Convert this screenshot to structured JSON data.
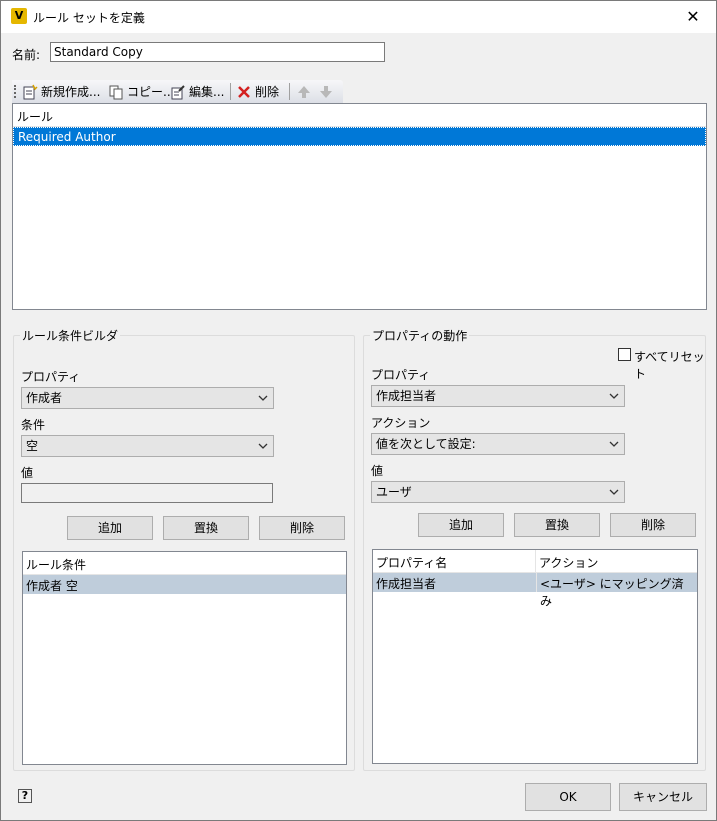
{
  "window": {
    "title": "ルール セットを定義",
    "app_icon_letter": "V",
    "close_glyph": "✕"
  },
  "name": {
    "label": "名前:",
    "value": "Standard Copy"
  },
  "toolbar": {
    "new_label": "新規作成...",
    "copy_label": "コピー...",
    "edit_label": "編集...",
    "delete_label": "削除"
  },
  "rules": {
    "header": "ルール",
    "items": [
      "Required Author"
    ]
  },
  "condition_builder": {
    "legend": "ルール条件ビルダ",
    "property_label": "プロパティ",
    "property_value": "作成者",
    "condition_label": "条件",
    "condition_value": "空",
    "value_label": "値",
    "value_text": "",
    "add_label": "追加",
    "replace_label": "置換",
    "delete_label": "削除",
    "list_header": "ルール条件",
    "list_items": [
      "作成者 空"
    ]
  },
  "property_action": {
    "legend": "プロパティの動作",
    "reset_all_label": "すべてリセット",
    "property_label": "プロパティ",
    "property_value": "作成担当者",
    "action_label": "アクション",
    "action_value": "値を次として設定:",
    "value_label": "値",
    "value_value": "ユーザ",
    "add_label": "追加",
    "replace_label": "置換",
    "delete_label": "削除",
    "columns": [
      "プロパティ名",
      "アクション"
    ],
    "rows": [
      [
        "作成担当者",
        "<ユーザ> にマッピング済み"
      ]
    ]
  },
  "footer": {
    "help_glyph": "?",
    "ok_label": "OK",
    "cancel_label": "キャンセル"
  },
  "colors": {
    "selection": "#0078d7",
    "inactive_selection": "#bfcddb",
    "dialog_bg": "#f0f0f0"
  }
}
